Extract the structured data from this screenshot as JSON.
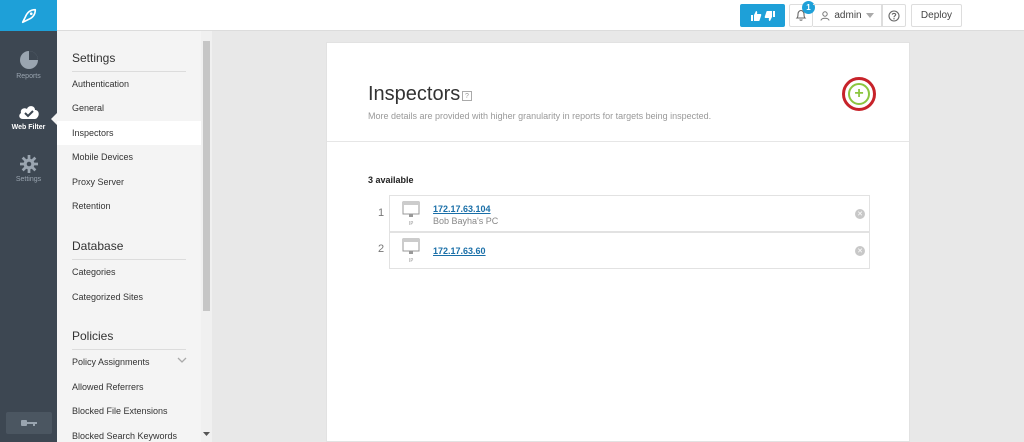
{
  "rail": {
    "items": [
      {
        "label": "Reports",
        "icon": "pie-chart-icon"
      },
      {
        "label": "Web Filter",
        "icon": "cloud-check-icon"
      },
      {
        "label": "Settings",
        "icon": "gear-icon"
      }
    ],
    "bottom_icon": "key-icon"
  },
  "topbar": {
    "notification_count": "1",
    "user": "admin",
    "deploy_label": "Deploy"
  },
  "nav": {
    "sections": [
      {
        "title": "Settings",
        "items": [
          "Authentication",
          "General",
          "Inspectors",
          "Mobile Devices",
          "Proxy Server",
          "Retention"
        ]
      },
      {
        "title": "Database",
        "items": [
          "Categories",
          "Categorized Sites"
        ]
      },
      {
        "title": "Policies",
        "items": [
          "Policy Assignments",
          "Allowed Referrers",
          "Blocked File Extensions",
          "Blocked Search Keywords"
        ]
      }
    ],
    "active": "Inspectors"
  },
  "page": {
    "title": "Inspectors",
    "help_glyph": "?",
    "subtitle": "More details are provided with higher granularity in reports for targets being inspected.",
    "available_label": "3 available",
    "rows": [
      {
        "num": "1",
        "ip": "172.17.63.104",
        "desc": "Bob Bayha's PC"
      },
      {
        "num": "2",
        "ip": "172.17.63.60",
        "desc": ""
      }
    ],
    "device_tag": "IP"
  },
  "colors": {
    "accent": "#1ea0d8",
    "rail": "#3d4752",
    "add_ring": "#c7232a",
    "add_green": "#8cc63f",
    "link": "#1a6fa8"
  }
}
